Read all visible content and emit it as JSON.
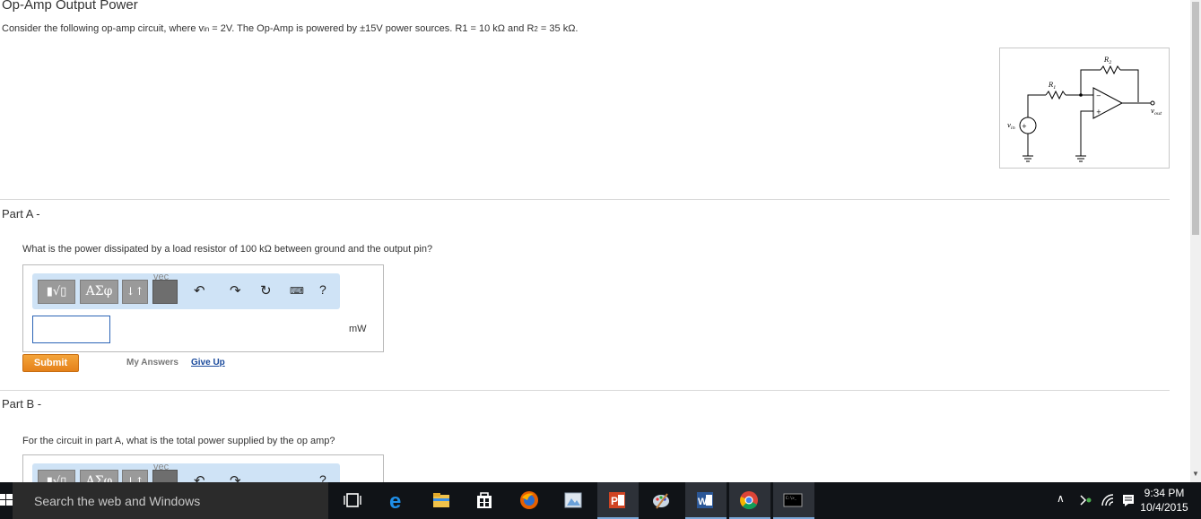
{
  "page": {
    "title": "Op-Amp Output Power",
    "intro_pre": "Consider the following op-amp circuit, where v",
    "intro_sub": "in",
    "intro_mid": " = 2V.  The Op-Amp is powered by ±15V power sources. R1 = 10 kΩ and R",
    "intro_sub2": "2",
    "intro_post": " = 35 kΩ."
  },
  "circuit": {
    "r2_label": "R",
    "r2_sub": "2",
    "r1_label": "R",
    "r1_sub": "1",
    "vin_label": "v",
    "vin_sub": "in",
    "vout_label": "v",
    "vout_sub": "out",
    "minus": "−",
    "plus": "+"
  },
  "part_a": {
    "title": "Part A -",
    "question": "What is the power dissipated by a load resistor of 100 kΩ between ground and the output pin?",
    "toolbar": {
      "templates_label": "▮√▯",
      "greek_label": "ΑΣφ",
      "updown_label": "↓↑",
      "vec_label": "vec",
      "help_label": "?"
    },
    "input_value": "",
    "units": "mW",
    "submit_label": "Submit",
    "my_answers_label": "My Answers",
    "give_up_label": "Give Up"
  },
  "part_b": {
    "title": "Part B -",
    "question": "For the circuit in part A, what is the total power supplied by the op amp?",
    "toolbar": {
      "templates_label": "▮√▯",
      "greek_label": "ΑΣφ",
      "updown_label": "↓↑",
      "vec_label": "vec",
      "help_label": "?"
    }
  },
  "taskbar": {
    "search_placeholder": "Search the web and Windows",
    "apps": [
      "task-view",
      "edge",
      "file-explorer",
      "store",
      "firefox",
      "photos",
      "powerpoint",
      "paint",
      "word",
      "chrome",
      "command-prompt"
    ],
    "word_letter": "W",
    "ppt_letter": "P",
    "cmd_text": "C:\\>_",
    "time": "9:34 PM",
    "date": "10/4/2015"
  },
  "colors": {
    "submit": "#e98b22",
    "toolbar_bg": "#cfe3f6",
    "link": "#1a4a9c",
    "taskbar": "#101317"
  }
}
